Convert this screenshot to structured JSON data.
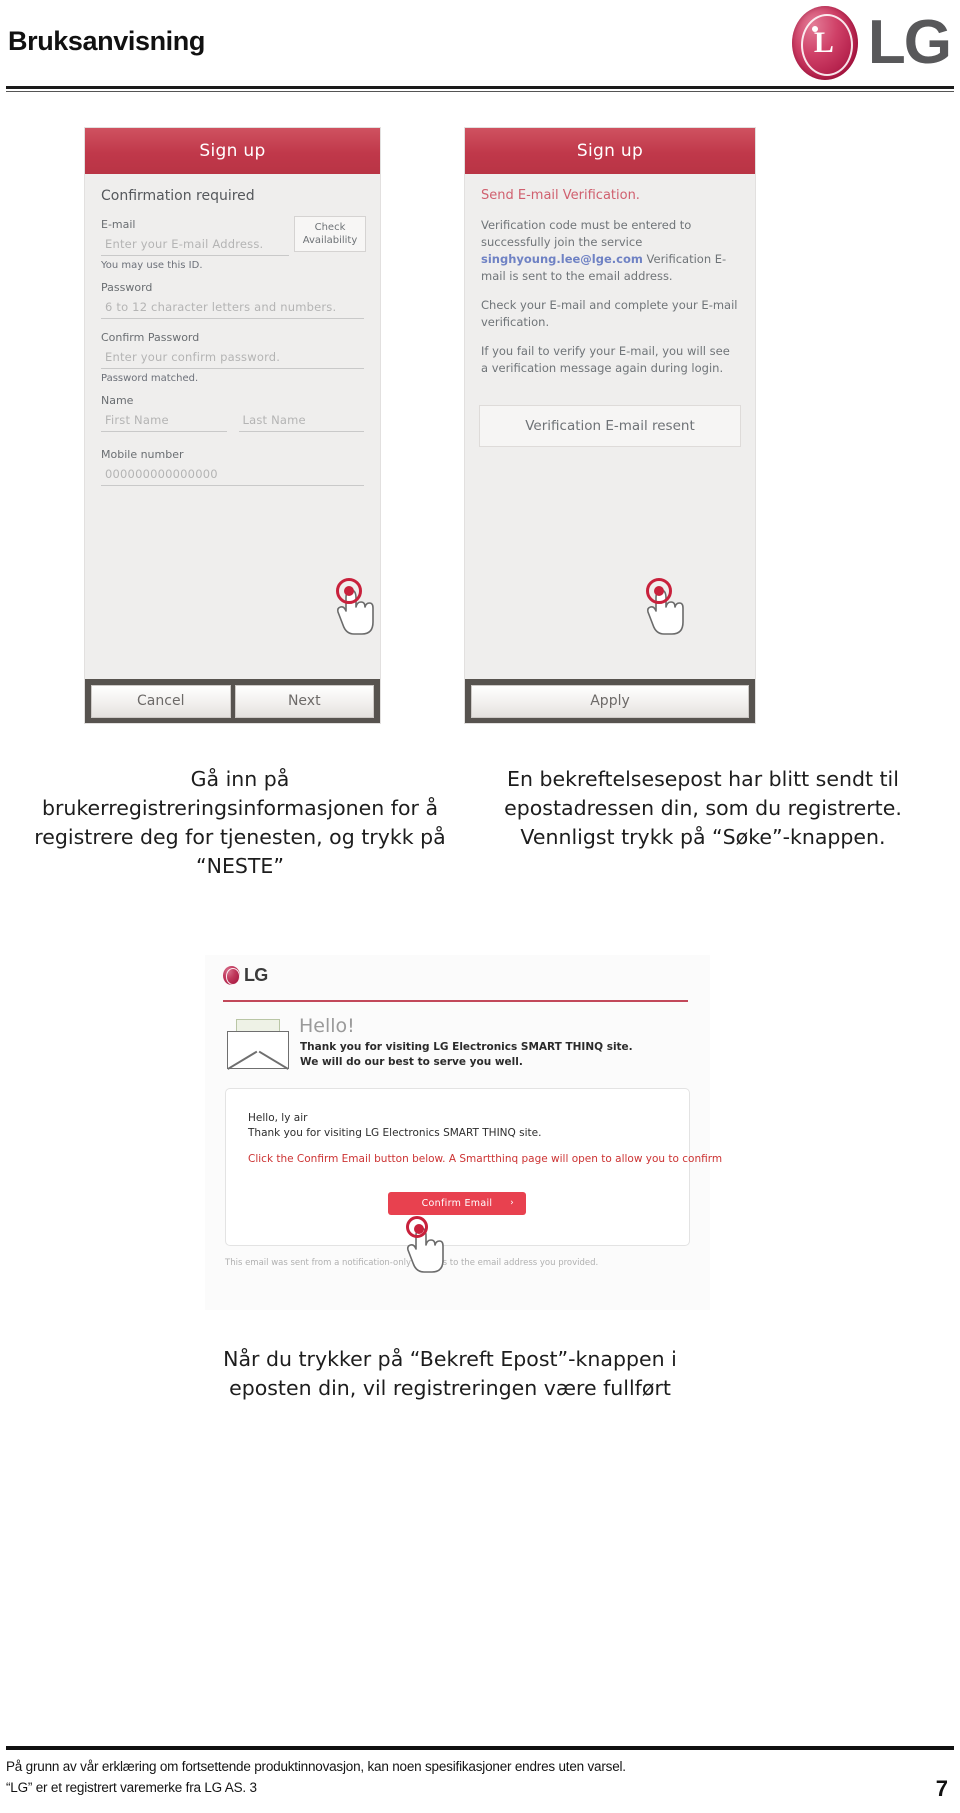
{
  "header": {
    "title": "Bruksanvisning",
    "logo_text": "LG"
  },
  "signup_form": {
    "title": "Sign up",
    "section_heading": "Confirmation required",
    "email_label": "E-mail",
    "email_placeholder": "Enter your E-mail Address.",
    "check_availability_line1": "Check",
    "check_availability_line2": "Availability",
    "email_hint": "You may use this ID.",
    "password_label": "Password",
    "password_placeholder": "6 to 12 character letters and numbers.",
    "confirm_password_label": "Confirm Password",
    "confirm_password_placeholder": "Enter your confirm password.",
    "password_hint": "Password matched.",
    "name_label": "Name",
    "first_name_placeholder": "First Name",
    "last_name_placeholder": "Last Name",
    "mobile_label": "Mobile number",
    "mobile_value": "000000000000000",
    "cancel_button": "Cancel",
    "next_button": "Next"
  },
  "verification_panel": {
    "title": "Sign up",
    "heading": "Send E-mail Verification.",
    "paragraph1_part1": "Verification code must be entered to successfully join the service ",
    "paragraph1_email": "singhyoung.lee@lge.com",
    "paragraph1_part2": " Verification E-mail is sent to the email address.",
    "paragraph2": "Check your E-mail and complete your E-mail verification.",
    "paragraph3": "If you fail to verify your E-mail, you will see a verification message again during login.",
    "resent_box": "Verification E-mail resent",
    "apply_button": "Apply"
  },
  "captions": {
    "left": "Gå inn på brukerregistreringsinformasjonen for å registrere deg for tjenesten, og trykk på “NESTE”",
    "right": "En bekreftelsesepost har blitt sendt til epostadressen din, som du registrerte. Vennligst trykk på “Søke”-knappen.",
    "bottom": "Når du trykker på “Bekreft Epost”-knappen i eposten din, vil registreringen være fullført"
  },
  "email_screenshot": {
    "logo_text": "LG",
    "hero_hello": "Hello!",
    "hero_line1": "Thank you for visiting LG Electronics SMART THINQ site.",
    "hero_line2": "We will do our best to serve you well.",
    "body_line1": "Hello, ly air",
    "body_line2": "Thank you for visiting LG Electronics SMART THINQ site.",
    "body_line3": "Click the Confirm Email button below. A Smartthinq page will open to allow you to confirm",
    "confirm_button": "Confirm Email",
    "confirm_button_arrow": "›",
    "footnote": "This email was sent from a notification-only address to the email address you provided."
  },
  "footer": {
    "line1": "På grunn av vår erklæring om fortsettende produktinnovasjon, kan noen spesifikasjoner endres uten varsel.",
    "line2": "“LG” er et registrert varemerke fra LG AS. 3",
    "page_number": "7"
  },
  "colors": {
    "brand_red": "#b93445",
    "accent_red": "#c8213c",
    "email_link": "#6f82c4"
  }
}
